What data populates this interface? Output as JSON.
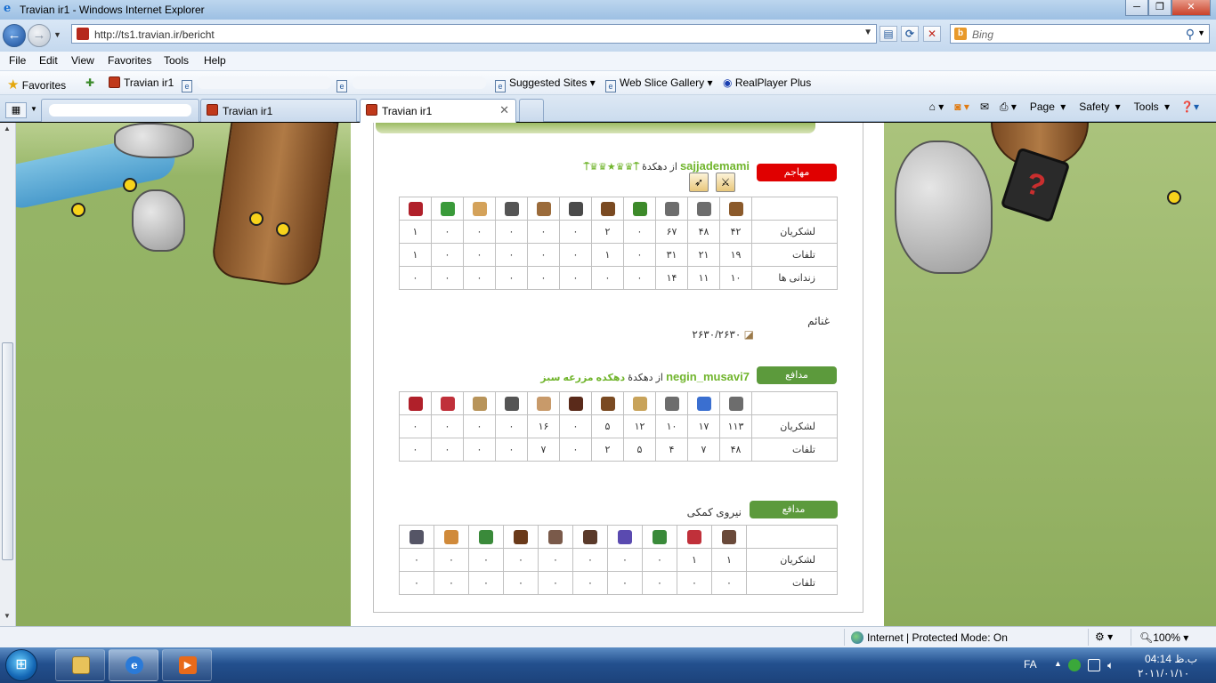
{
  "window": {
    "title": "Travian ir1 - Windows Internet Explorer",
    "controls": [
      "─",
      "❐",
      "✕"
    ]
  },
  "address": {
    "url": "http://ts1.travian.ir/bericht"
  },
  "search": {
    "placeholder": "Bing"
  },
  "menu": [
    "File",
    "Edit",
    "View",
    "Favorites",
    "Tools",
    "Help"
  ],
  "favorites_bar": {
    "favorites_label": "Favorites",
    "travian": "Travian ir1",
    "suggested": "Suggested Sites",
    "webslice": "Web Slice Gallery",
    "realplayer": "RealPlayer Plus"
  },
  "tabs": [
    {
      "label": "Travian ir1",
      "active": false
    },
    {
      "label": "Travian ir1",
      "active": true
    }
  ],
  "command_bar": {
    "page": "Page",
    "safety": "Safety",
    "tools": "Tools"
  },
  "report": {
    "attacker": {
      "badge": "مهاجم",
      "player": "sajjademami",
      "from_text": "از دهکدهٔ",
      "village_glyphs": "⍑♛♛★♛♛⍑",
      "icon_colors": [
        "#8b5a2b",
        "#6d6d6d",
        "#6d6d6d",
        "#3d8a2a",
        "#7a4a22",
        "#4a4a4a",
        "#9b6b3a",
        "#555555",
        "#d4a25a",
        "#3a9a3a",
        "#b0202a"
      ],
      "rows": [
        {
          "label": "لشکریان",
          "values": [
            "۴۲",
            "۴۸",
            "۶۷",
            "۰",
            "۲",
            "۰",
            "۰",
            "۰",
            "۰",
            "۰",
            "۱"
          ]
        },
        {
          "label": "تلفات",
          "values": [
            "۱۹",
            "۲۱",
            "۳۱",
            "۰",
            "۱",
            "۰",
            "۰",
            "۰",
            "۰",
            "۰",
            "۱"
          ]
        },
        {
          "label": "زندانی ها",
          "values": [
            "۱۰",
            "۱۱",
            "۱۴",
            "۰",
            "۰",
            "۰",
            "۰",
            "۰",
            "۰",
            "۰",
            "۰"
          ]
        }
      ],
      "booty_label": "غنائم",
      "booty_value": "۲۶۳۰/۲۶۳۰"
    },
    "defender1": {
      "badge": "مدافع",
      "player": "negin_musavi7",
      "from_text": "از دهکدهٔ",
      "village": "دهکده مزرعه سبز",
      "icon_colors": [
        "#6d6d6d",
        "#3a6fd0",
        "#6d6d6d",
        "#c8a35a",
        "#7a4a22",
        "#5a2a1a",
        "#c89a6a",
        "#555555",
        "#b8945a",
        "#c0303a",
        "#b0202a"
      ],
      "rows": [
        {
          "label": "لشکریان",
          "values": [
            "۱۱۳",
            "۱۷",
            "۱۰",
            "۱۲",
            "۵",
            "۰",
            "۱۶",
            "۰",
            "۰",
            "۰",
            "۰"
          ]
        },
        {
          "label": "تلفات",
          "values": [
            "۴۸",
            "۷",
            "۴",
            "۵",
            "۲",
            "۰",
            "۷",
            "۰",
            "۰",
            "۰",
            "۰"
          ]
        }
      ]
    },
    "defender2": {
      "badge": "مدافع",
      "title": "نیروی کمکی",
      "icon_colors": [
        "#6a4a3a",
        "#c0303a",
        "#3a8a3a",
        "#5a4ab0",
        "#5a3a2a",
        "#7a5a4a",
        "#6a3a1a",
        "#3a8a3a",
        "#d08a3a",
        "#555566"
      ],
      "rows": [
        {
          "label": "لشکریان",
          "values": [
            "۱",
            "۱",
            "۰",
            "۰",
            "۰",
            "۰",
            "۰",
            "۰",
            "۰",
            "۰"
          ]
        },
        {
          "label": "تلفات",
          "values": [
            "۰",
            "۰",
            "۰",
            "۰",
            "۰",
            "۰",
            "۰",
            "۰",
            "۰",
            "۰"
          ]
        }
      ]
    }
  },
  "statusbar": {
    "zone": "Internet | Protected Mode: On",
    "zoom": "100%"
  },
  "taskbar": {
    "lang": "FA",
    "time": "ب.ظ 04:14",
    "date": "۲۰۱۱/۰۱/۱۰"
  }
}
